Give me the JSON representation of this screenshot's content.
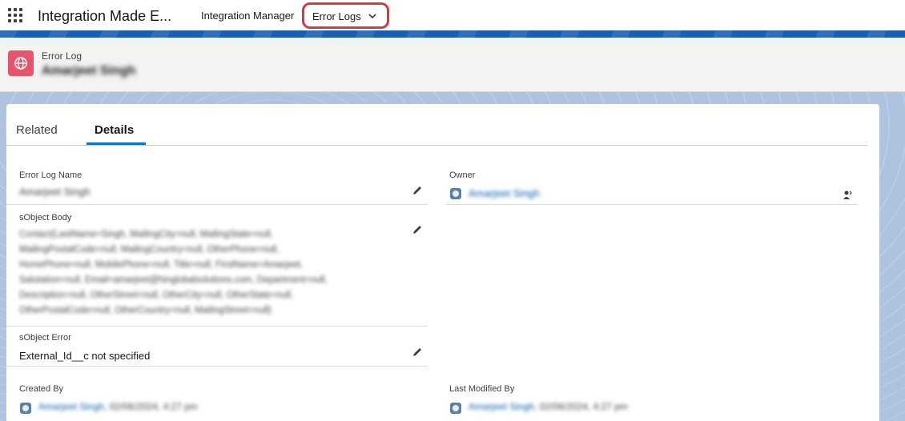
{
  "nav": {
    "app_name": "Integration Made E...",
    "items": [
      {
        "label": "Integration Manager"
      },
      {
        "label": "Error Logs"
      }
    ]
  },
  "record": {
    "type": "Error Log",
    "title": "Amarjeet Singh"
  },
  "tabs": [
    {
      "label": "Related"
    },
    {
      "label": "Details",
      "active": true
    }
  ],
  "fields": {
    "error_log_name": {
      "label": "Error Log Name",
      "value": "Amarjeet Singh"
    },
    "owner": {
      "label": "Owner",
      "value": "Amarjeet Singh"
    },
    "sobject_body": {
      "label": "sObject Body",
      "lines": [
        "Contact{LastName=Singh, MailingCity=null, MailingState=null,",
        "MailingPostalCode=null, MailingCountry=null, OtherPhone=null,",
        "HomePhone=null, MobilePhone=null, Title=null, FirstName=Amarjeet,",
        "Salutation=null, Email=amarjeet@hinglobalsolutions.com, Department=null,",
        "Description=null, OtherStreet=null, OtherCity=null, OtherState=null,",
        "OtherPostalCode=null, OtherCountry=null, MailingStreet=null}"
      ]
    },
    "sobject_error": {
      "label": "sObject Error",
      "value": "External_Id__c not specified"
    },
    "created_by": {
      "label": "Created By",
      "user": "Amarjeet Singh",
      "date": ", 02/06/2024, 4:27 pm"
    },
    "last_modified_by": {
      "label": "Last Modified By",
      "user": "Amarjeet Singh",
      "date": ", 02/06/2024, 4:27 pm"
    }
  },
  "colors": {
    "accent": "#0176d3",
    "record_icon": "#e8546b",
    "nav_highlight_border": "#d83a3a",
    "brand_strip": "#1b5fb0"
  }
}
